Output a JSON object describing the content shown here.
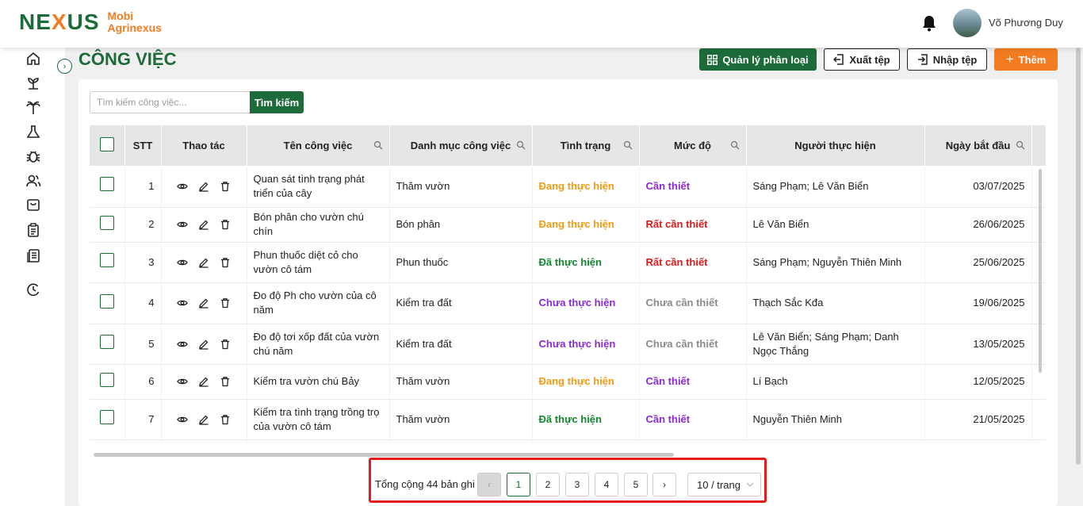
{
  "app": {
    "logo_mark_left": "NE",
    "logo_mark_x": "X",
    "logo_mark_right": "US",
    "brand_line1": "Mobi",
    "brand_line2": "Agrinexus",
    "user_name": "Võ Phương Duy"
  },
  "page": {
    "title": "CÔNG VIỆC",
    "btn_categories": "Quản lý phân loại",
    "btn_export": "Xuất tệp",
    "btn_import": "Nhập tệp",
    "btn_add": "Thêm"
  },
  "search": {
    "placeholder": "Tìm kiếm công việc...",
    "button": "Tìm kiếm"
  },
  "table": {
    "headers": {
      "stt": "STT",
      "actions": "Thao tác",
      "name": "Tên công việc",
      "category": "Danh mục công việc",
      "status": "Tình trạng",
      "level": "Mức độ",
      "assignee": "Người thực hiện",
      "start_date": "Ngày bắt đầu"
    },
    "rows": [
      {
        "stt": "1",
        "name": "Quan sát tình trạng phát triển của cây",
        "category": "Thăm vườn",
        "status": "Đang thực hiện",
        "level": "Cần thiết",
        "assignee": "Sáng Phạm; Lê  Văn Biển",
        "date": "03/07/2025"
      },
      {
        "stt": "2",
        "name": "Bón phân cho vườn chú chín",
        "category": "Bón phân",
        "status": "Đang thực hiện",
        "level": "Rất cần thiết",
        "assignee": "Lê  Văn Biển",
        "date": "26/06/2025"
      },
      {
        "stt": "3",
        "name": "Phun thuốc diệt cỏ cho vườn cô tám",
        "category": "Phun thuốc",
        "status": "Đã thực hiện",
        "level": "Rất cần thiết",
        "assignee": "Sáng Phạm; Nguyễn  Thiên Minh",
        "date": "25/06/2025"
      },
      {
        "stt": "4",
        "name": "Đo độ Ph cho vườn của cô năm",
        "category": "Kiểm tra đất",
        "status": "Chưa thực hiện",
        "level": "Chưa cần thiết",
        "assignee": "Thạch Sắc Kđa",
        "date": "19/06/2025"
      },
      {
        "stt": "5",
        "name": "Đo độ tơi xốp đất của vườn chú năm",
        "category": "Kiểm tra đất",
        "status": "Chưa thực hiện",
        "level": "Chưa cần thiết",
        "assignee": "Lê  Văn Biển; Sáng Phạm; Danh  Ngọc Thắng",
        "date": "13/05/2025"
      },
      {
        "stt": "6",
        "name": "Kiểm tra vườn chú Bảy",
        "category": "Thăm vườn",
        "status": "Đang thực hiện",
        "level": "Cần thiết",
        "assignee": "Lí  Bạch",
        "date": "12/05/2025"
      },
      {
        "stt": "7",
        "name": "Kiểm tra tình trạng trồng trọ của vườn cô tám",
        "category": "Thăm vườn",
        "status": "Đã thực hiện",
        "level": "Cần thiết",
        "assignee": "Nguyễn  Thiên Minh",
        "date": "21/05/2025"
      }
    ]
  },
  "pagination": {
    "total_text": "Tổng cộng 44 bản ghi",
    "pages": [
      "1",
      "2",
      "3",
      "4",
      "5"
    ],
    "current": "1",
    "next": "›",
    "prev": "‹",
    "page_size": "10 / trang"
  },
  "colors": {
    "brand_green": "#1d6b3a",
    "brand_orange": "#f47c20",
    "highlight_red": "#e41b1b"
  }
}
